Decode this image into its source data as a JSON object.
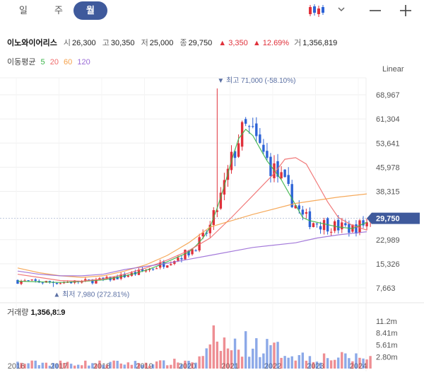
{
  "toolbar": {
    "periods": [
      "일",
      "주",
      "월"
    ],
    "selected_period": "월",
    "candle_icon": "candlestick-chart-icon",
    "dropdown_icon": "chevron-down-icon",
    "zoom_out_icon": "minus-icon",
    "zoom_in_icon": "plus-icon"
  },
  "stock": {
    "name": "이노와이어리스",
    "open_label": "시",
    "open": "26,300",
    "high_label": "고",
    "high": "30,350",
    "low_label": "저",
    "low": "25,000",
    "close_label": "종",
    "close": "29,750",
    "change": "▲ 3,350",
    "change_pct": "▲ 12.69%",
    "volume_label": "거",
    "volume": "1,356,819"
  },
  "moving_average": {
    "label": "이동평균",
    "periods": [
      {
        "value": "5",
        "color": "#3bb54a"
      },
      {
        "value": "20",
        "color": "#f06b6b"
      },
      {
        "value": "60",
        "color": "#f5a14a"
      },
      {
        "value": "120",
        "color": "#9a6bd6"
      }
    ]
  },
  "scale_mode": "Linear",
  "volume_panel": {
    "label": "거래량",
    "value": "1,356,819"
  },
  "colors": {
    "up": "#e0313b",
    "down": "#2d63d6",
    "accent": "#3f5a9c"
  },
  "chart_data": {
    "type": "candlestick",
    "y_ticks": [
      "68,967",
      "61,304",
      "53,641",
      "45,978",
      "38,315",
      "29,750",
      "22,989",
      "15,326",
      "7,663"
    ],
    "y_tick_values": [
      68967,
      61304,
      53641,
      45978,
      38315,
      29750,
      22989,
      15326,
      7663
    ],
    "x_ticks": [
      "2016",
      "2017",
      "2018",
      "2019",
      "2020",
      "2021",
      "2022",
      "2023",
      "2024"
    ],
    "volume_ticks": [
      "11.2m",
      "8.41m",
      "5.61m",
      "2.80m"
    ],
    "volume_tick_values": [
      11200000,
      8410000,
      5610000,
      2800000
    ],
    "current_price": "29,750",
    "current_value": 29750,
    "annotations": {
      "high": {
        "text": "최고 71,000 (-58.10%)",
        "value": 71000,
        "date": "2020-09"
      },
      "low": {
        "text": "최저 7,980 (272.81%)",
        "value": 7980,
        "date": "2016-11"
      }
    },
    "series": [
      {
        "name": "5",
        "values": [
          9800,
          9600,
          9400,
          9700,
          10200,
          10800,
          11500,
          12300,
          13300,
          14500,
          16000,
          17500,
          19000,
          21000,
          23500,
          27000,
          33000,
          40000,
          48000,
          55000,
          58000,
          56000,
          52000,
          48000,
          45000,
          42000,
          38000,
          34000,
          30000,
          29000,
          28000,
          27000,
          26500,
          28500
        ],
        "dates": [
          "2016-01",
          "2016-07",
          "2017-01",
          "2017-07",
          "2018-01",
          "2018-04",
          "2018-07",
          "2018-10",
          "2019-01",
          "2019-04",
          "2019-07",
          "2019-10",
          "2020-01",
          "2020-03",
          "2020-05",
          "2020-07",
          "2020-09",
          "2020-11",
          "2021-01",
          "2021-03",
          "2021-05",
          "2021-07",
          "2021-09",
          "2021-11",
          "2022-01",
          "2022-03",
          "2022-05",
          "2022-07",
          "2022-09",
          "2022-11",
          "2023-03",
          "2023-07",
          "2023-11",
          "2024-03"
        ]
      },
      {
        "name": "20",
        "values": [
          12000,
          11000,
          10000,
          9800,
          10500,
          12000,
          14000,
          16500,
          19500,
          23500,
          30000,
          37000,
          44000,
          48500,
          49000,
          47000,
          41000,
          35000,
          30000,
          27500,
          26000
        ],
        "dates": [
          "2016-01",
          "2016-07",
          "2017-01",
          "2017-07",
          "2018-01",
          "2018-07",
          "2019-01",
          "2019-07",
          "2020-01",
          "2020-07",
          "2021-01",
          "2021-07",
          "2022-01",
          "2022-04",
          "2022-07",
          "2022-10",
          "2023-01",
          "2023-04",
          "2023-07",
          "2023-11",
          "2024-03"
        ]
      },
      {
        "name": "60",
        "values": [
          14000,
          12500,
          11500,
          11000,
          11500,
          13000,
          15000,
          18000,
          22000,
          27000,
          31000,
          34500,
          36500,
          37500
        ],
        "dates": [
          "2016-01",
          "2016-07",
          "2017-01",
          "2017-07",
          "2018-01",
          "2018-07",
          "2019-01",
          "2019-07",
          "2020-01",
          "2020-07",
          "2021-07",
          "2022-07",
          "2023-07",
          "2024-03"
        ]
      },
      {
        "name": "120",
        "values": [
          13000,
          12000,
          11500,
          11500,
          12000,
          13500,
          15500,
          18000,
          20500,
          22000,
          23500,
          24500,
          25500
        ],
        "dates": [
          "2016-01",
          "2016-07",
          "2017-01",
          "2017-07",
          "2018-01",
          "2018-07",
          "2019-07",
          "2020-07",
          "2021-07",
          "2022-07",
          "2023-01",
          "2023-07",
          "2024-03"
        ]
      }
    ]
  }
}
